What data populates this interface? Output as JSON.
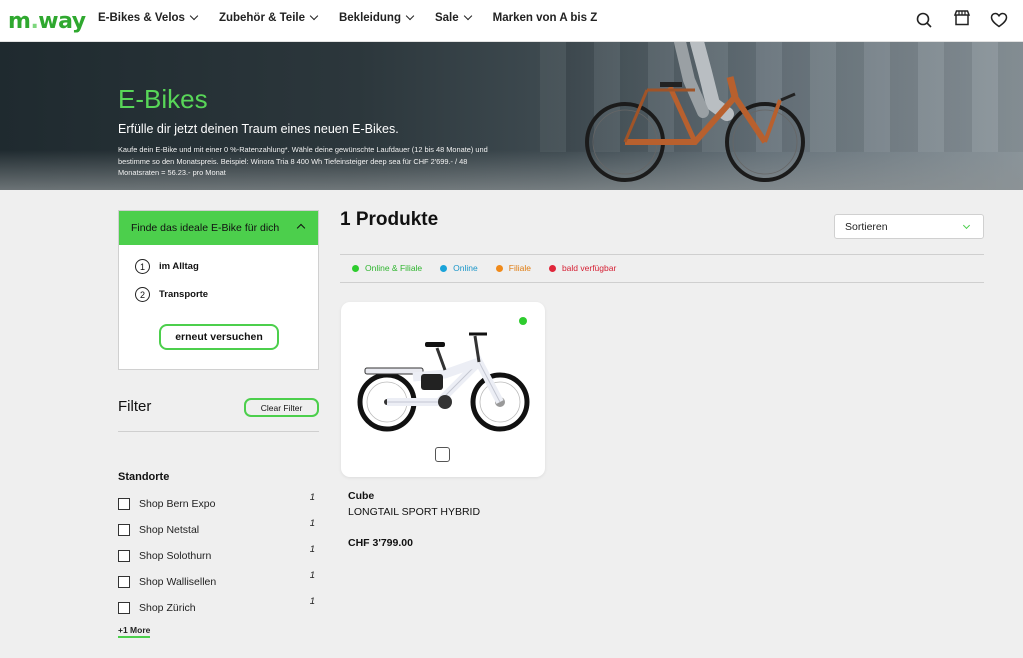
{
  "header": {
    "logo_main": "m",
    "logo_dot": ".",
    "logo_rest": "way",
    "nav": [
      {
        "label": "E-Bikes & Velos"
      },
      {
        "label": "Zubehör & Teile"
      },
      {
        "label": "Bekleidung"
      },
      {
        "label": "Sale"
      },
      {
        "label": "Marken von A bis Z"
      }
    ],
    "icons": [
      "search-icon",
      "store-icon",
      "heart-icon"
    ]
  },
  "hero": {
    "title": "E-Bikes",
    "subtitle": "Erfülle dir jetzt deinen Traum eines neuen E-Bikes.",
    "text": "Kaufe dein E-Bike und mit einer 0 %-Ratenzahlung*. Wähle deine gewünschte Laufdauer (12 bis 48 Monate) und bestimme so den Monatspreis. Beispiel: Winora Tria 8 400 Wh Tiefeinsteiger deep sea für CHF 2'699.- / 48 Monatsraten = 56.23.- pro Monat"
  },
  "finder": {
    "title": "Finde das ideale E-Bike für dich",
    "steps": [
      {
        "num": "1",
        "label": "im Alltag"
      },
      {
        "num": "2",
        "label": "Transporte"
      }
    ],
    "retry_label": "erneut versuchen"
  },
  "filter": {
    "title": "Filter",
    "clear_label": "Clear Filter",
    "standorte_title": "Standorte",
    "locations": [
      {
        "name": "Shop Bern Expo",
        "count": "1"
      },
      {
        "name": "Shop Netstal",
        "count": "1"
      },
      {
        "name": "Shop Solothurn",
        "count": "1"
      },
      {
        "name": "Shop Wallisellen",
        "count": "1"
      },
      {
        "name": "Shop Zürich",
        "count": "1"
      }
    ],
    "more_label": "+1 More"
  },
  "main": {
    "product_count": "1 Produkte",
    "sort_label": "Sortieren",
    "legend": [
      {
        "label": "Online & Filiale",
        "color": "#2ecc2e"
      },
      {
        "label": "Online",
        "color": "#1aa3d9"
      },
      {
        "label": "Filiale",
        "color": "#f08a1a"
      },
      {
        "label": "bald verfügbar",
        "color": "#e0263a"
      }
    ],
    "products": [
      {
        "brand": "Cube",
        "model": "LONGTAIL SPORT HYBRID",
        "price": "CHF 3'799.00",
        "availability_color": "#2ecc2e"
      }
    ]
  },
  "colors": {
    "accent": "#4ccf4c",
    "hero_title": "#58d658"
  }
}
